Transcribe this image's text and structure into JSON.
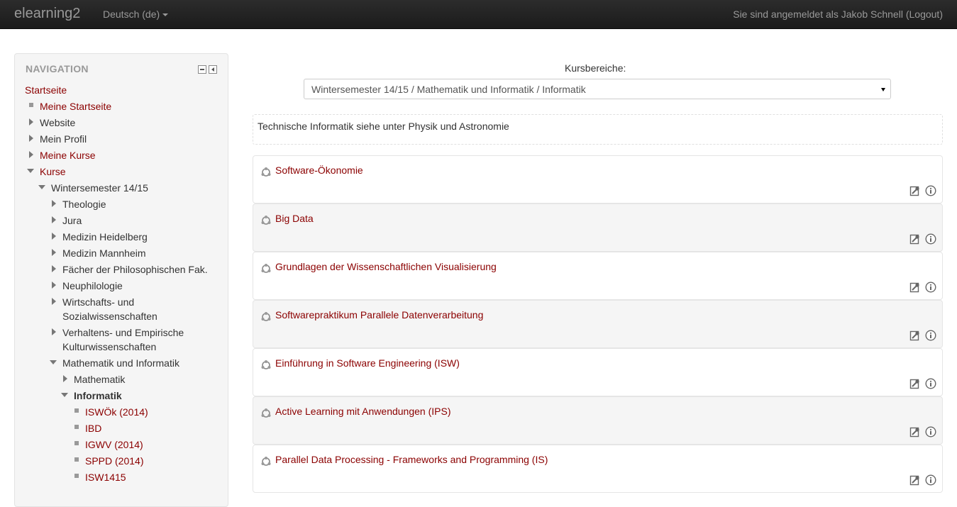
{
  "navbar": {
    "brand": "elearning2",
    "language": "Deutsch (de)",
    "login_prefix": "Sie sind angemeldet als Jakob Schnell (",
    "logout": "Logout",
    "login_suffix": ")"
  },
  "nav": {
    "header": "NAVIGATION",
    "items": [
      {
        "label": "Startseite",
        "link": true
      },
      {
        "label": "Meine Startseite",
        "link": true
      },
      {
        "label": "Website",
        "link": false
      },
      {
        "label": "Mein Profil",
        "link": false
      },
      {
        "label": "Meine Kurse",
        "link": true
      },
      {
        "label": "Kurse",
        "link": true
      },
      {
        "label": "Wintersemester 14/15",
        "link": false
      },
      {
        "label": "Theologie",
        "link": false
      },
      {
        "label": "Jura",
        "link": false
      },
      {
        "label": "Medizin Heidelberg",
        "link": false
      },
      {
        "label": "Medizin Mannheim",
        "link": false
      },
      {
        "label": "Fächer der Philosophischen Fak.",
        "link": false
      },
      {
        "label": "Neuphilologie",
        "link": false
      },
      {
        "label": "Wirtschafts- und",
        "link": false
      },
      {
        "label": "Sozialwissenschaften",
        "link": false
      },
      {
        "label": "Verhaltens- und Empirische",
        "link": false
      },
      {
        "label": "Kulturwissenschaften",
        "link": false
      },
      {
        "label": "Mathematik und Informatik",
        "link": false
      },
      {
        "label": "Mathematik",
        "link": false
      },
      {
        "label": "Informatik",
        "link": false
      },
      {
        "label": "ISWÖk (2014)",
        "link": true
      },
      {
        "label": "IBD",
        "link": true
      },
      {
        "label": "IGWV (2014)",
        "link": true
      },
      {
        "label": "SPPD (2014)",
        "link": true
      },
      {
        "label": "ISW1415",
        "link": true
      }
    ]
  },
  "main": {
    "category_label": "Kursbereiche:",
    "category_selected": "Wintersemester 14/15 / Mathematik und Informatik / Informatik",
    "info_text": "Technische Informatik siehe unter Physik und Astronomie",
    "courses": [
      "Software-Ökonomie",
      "Big Data",
      "Grundlagen der Wissenschaftlichen Visualisierung",
      "Softwarepraktikum Parallele Datenverarbeitung",
      "Einführung in Software Engineering (ISW)",
      "Active Learning mit Anwendungen (IPS)",
      "Parallel Data Processing - Frameworks and Programming (IS)"
    ]
  },
  "colors": {
    "link": "#8b0000",
    "navbar_bg": "#1b1b1b",
    "muted": "#999999"
  }
}
